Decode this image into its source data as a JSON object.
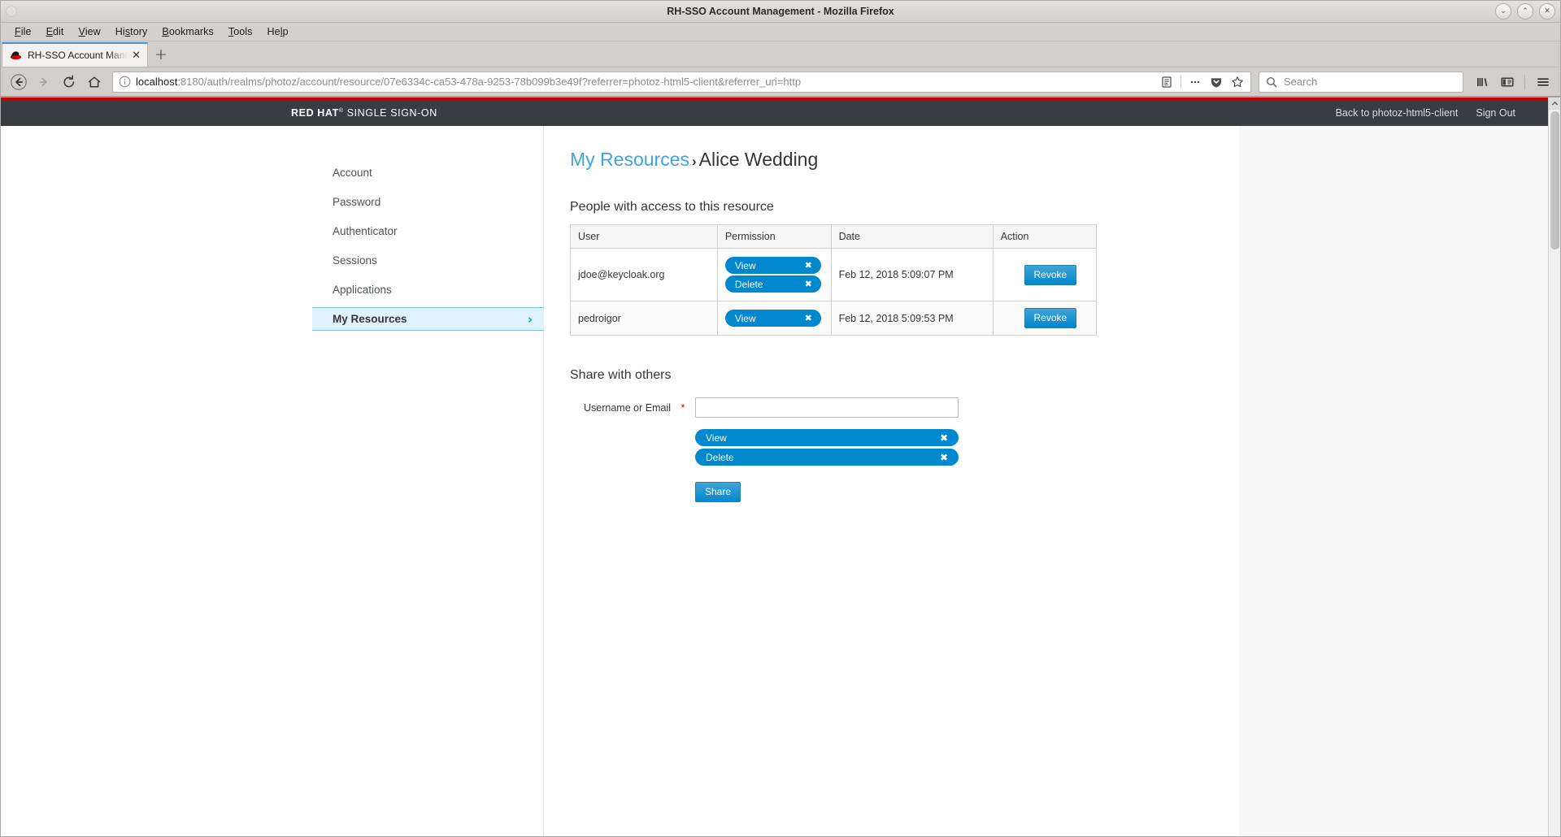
{
  "window": {
    "title": "RH-SSO Account Management - Mozilla Firefox",
    "minimize_label": "⌄",
    "maximize_label": "⌃",
    "close_label": "✕"
  },
  "menubar": {
    "items": [
      {
        "pre": "",
        "accel": "F",
        "post": "ile"
      },
      {
        "pre": "",
        "accel": "E",
        "post": "dit"
      },
      {
        "pre": "",
        "accel": "V",
        "post": "iew"
      },
      {
        "pre": "Hi",
        "accel": "s",
        "post": "tory"
      },
      {
        "pre": "",
        "accel": "B",
        "post": "ookmarks"
      },
      {
        "pre": "",
        "accel": "T",
        "post": "ools"
      },
      {
        "pre": "He",
        "accel": "l",
        "post": "p"
      }
    ]
  },
  "tabs": {
    "items": [
      {
        "title": "RH-SSO Account Manage",
        "favicon": "redhat-fedora-icon",
        "close_label": "✕"
      }
    ],
    "newtab_label": "+"
  },
  "toolbar": {
    "back_icon": "back-arrow-icon",
    "forward_icon": "forward-arrow-icon",
    "reload_icon": "reload-icon",
    "home_icon": "home-icon",
    "url_host": "localhost",
    "url_rest": ":8180/auth/realms/photoz/account/resource/07e6334c-ca53-478a-9253-78b099b3e49f?referrer=photoz-html5-client&referrer_uri=http",
    "url_info_icon": "info-circle-icon",
    "reader_icon": "reader-view-icon",
    "page_actions_icon": "ellipsis-icon",
    "pocket_icon": "pocket-shield-icon",
    "bookmark_icon": "star-icon",
    "search_icon": "search-icon",
    "search_placeholder": "Search",
    "library_icon": "library-icon",
    "sidebar_icon": "sidebar-toggle-icon",
    "menu_icon": "hamburger-menu-icon"
  },
  "header": {
    "brand_bold": "RED HAT",
    "brand_reg": "®",
    "brand_rest": "SINGLE SIGN-ON",
    "links": [
      {
        "label": "Back to photoz-html5-client"
      },
      {
        "label": "Sign Out"
      }
    ]
  },
  "sidebar": {
    "items": [
      {
        "label": "Account",
        "active": false
      },
      {
        "label": "Password",
        "active": false
      },
      {
        "label": "Authenticator",
        "active": false
      },
      {
        "label": "Sessions",
        "active": false
      },
      {
        "label": "Applications",
        "active": false
      },
      {
        "label": "My Resources",
        "active": true,
        "chevron": "›"
      }
    ]
  },
  "main": {
    "breadcrumb": {
      "link": "My Resources",
      "separator": "›",
      "current": "Alice Wedding"
    },
    "access_section": {
      "title": "People with access to this resource",
      "columns": [
        "User",
        "Permission",
        "Date",
        "Action"
      ],
      "rows": [
        {
          "user": "jdoe@keycloak.org",
          "permissions": [
            "View",
            "Delete"
          ],
          "date": "Feb 12, 2018 5:09:07 PM",
          "action_label": "Revoke"
        },
        {
          "user": "pedroigor",
          "permissions": [
            "View"
          ],
          "date": "Feb 12, 2018 5:09:53 PM",
          "action_label": "Revoke"
        }
      ],
      "pill_remove_label": "✖"
    },
    "share_section": {
      "title": "Share with others",
      "field_label": "Username or Email",
      "required_marker": "*",
      "field_value": "",
      "field_placeholder": "",
      "permissions": [
        "View",
        "Delete"
      ],
      "pill_remove_label": "✖",
      "submit_label": "Share"
    }
  },
  "scrollbar": {
    "up_arrow": "▲"
  },
  "colors": {
    "brand_red": "#cc0000",
    "header_dark": "#383d41",
    "accent_blue": "#0088ce",
    "link_blue": "#41a3dc",
    "active_nav_bg": "#def3ff"
  }
}
